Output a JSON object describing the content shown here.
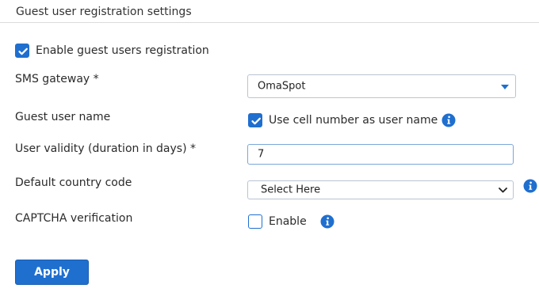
{
  "section": {
    "title": "Guest user registration settings"
  },
  "enable_registration": {
    "label": "Enable guest users registration",
    "checked": true
  },
  "sms_gateway": {
    "label": "SMS gateway *",
    "value": "OmaSpot"
  },
  "guest_user_name": {
    "label": "Guest user name",
    "option_label": "Use cell number as user name",
    "checked": true
  },
  "user_validity": {
    "label": "User validity (duration in days) *",
    "value": "7"
  },
  "country_code": {
    "label": "Default country code",
    "value": "Select Here"
  },
  "captcha": {
    "label": "CAPTCHA verification",
    "option_label": "Enable",
    "checked": false
  },
  "apply_button": {
    "label": "Apply"
  },
  "colors": {
    "accent": "#1f6fcf",
    "field_border": "#b9c4d3",
    "focus_border": "#7aa7d9"
  },
  "icons": {
    "checkbox_check": "check-icon",
    "info": "info-icon",
    "dropdown": "caret-down-icon",
    "chevron": "chevron-down-icon"
  }
}
